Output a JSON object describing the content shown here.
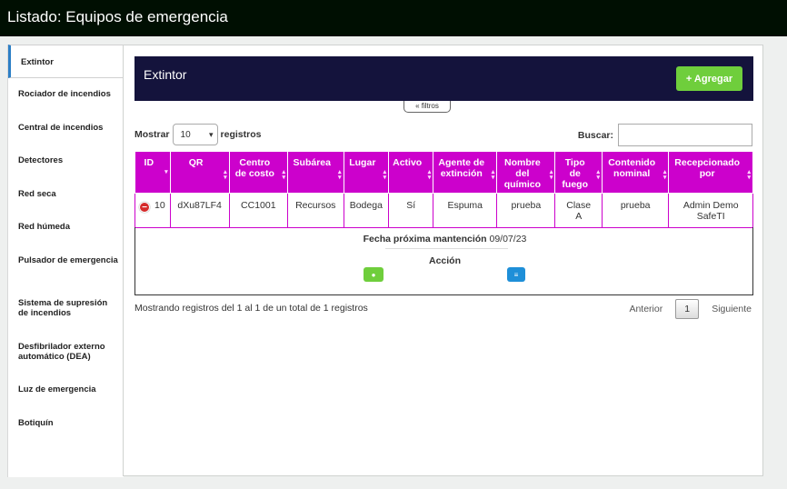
{
  "header": {
    "title": "Listado: Equipos de emergencia"
  },
  "sidebar": {
    "items": [
      {
        "label": "Extintor"
      },
      {
        "label": "Rociador de incendios"
      },
      {
        "label": "Central de incendios"
      },
      {
        "label": "Detectores"
      },
      {
        "label": "Red seca"
      },
      {
        "label": "Red húmeda"
      },
      {
        "label": "Pulsador de emergencia"
      },
      {
        "label": "Sistema de supresión de incendios"
      },
      {
        "label": "Desfibrilador externo automático (DEA)"
      },
      {
        "label": "Luz de emergencia"
      },
      {
        "label": "Botiquín"
      }
    ]
  },
  "panel": {
    "title": "Extintor",
    "add_label": "+ Agregar",
    "filters_label": "« filtros"
  },
  "controls": {
    "show_label": "Mostrar",
    "show_value": "10",
    "registros_label": "registros",
    "search_label": "Buscar:",
    "search_value": ""
  },
  "table": {
    "columns": [
      "ID",
      "QR",
      "Centro de costo",
      "Subárea",
      "Lugar",
      "Activo",
      "Agente de extinción",
      "Nombre del químico",
      "Tipo de fuego",
      "Contenido nominal",
      "Recepcionado por"
    ],
    "rows": [
      {
        "id": "10",
        "qr": "dXu87LF4",
        "centro": "CC1001",
        "subarea": "Recursos",
        "lugar": "Bodega",
        "activo": "Sí",
        "agente": "Espuma",
        "quimico": "prueba",
        "tipo": "Clase A",
        "contenido": "prueba",
        "recepcionado": "Admin Demo SafeTI"
      }
    ],
    "detail": {
      "fecha_label": "Fecha próxima mantención",
      "fecha_value": "09/07/23",
      "accion_label": "Acción"
    }
  },
  "footer": {
    "info": "Mostrando registros del 1 al 1 de un total de 1 registros",
    "prev": "Anterior",
    "page": "1",
    "next": "Siguiente"
  },
  "colors": {
    "header_bg": "#000f02",
    "table_header": "#cc01cc",
    "panel_head": "#14133c",
    "add_button": "#6fce3c"
  }
}
